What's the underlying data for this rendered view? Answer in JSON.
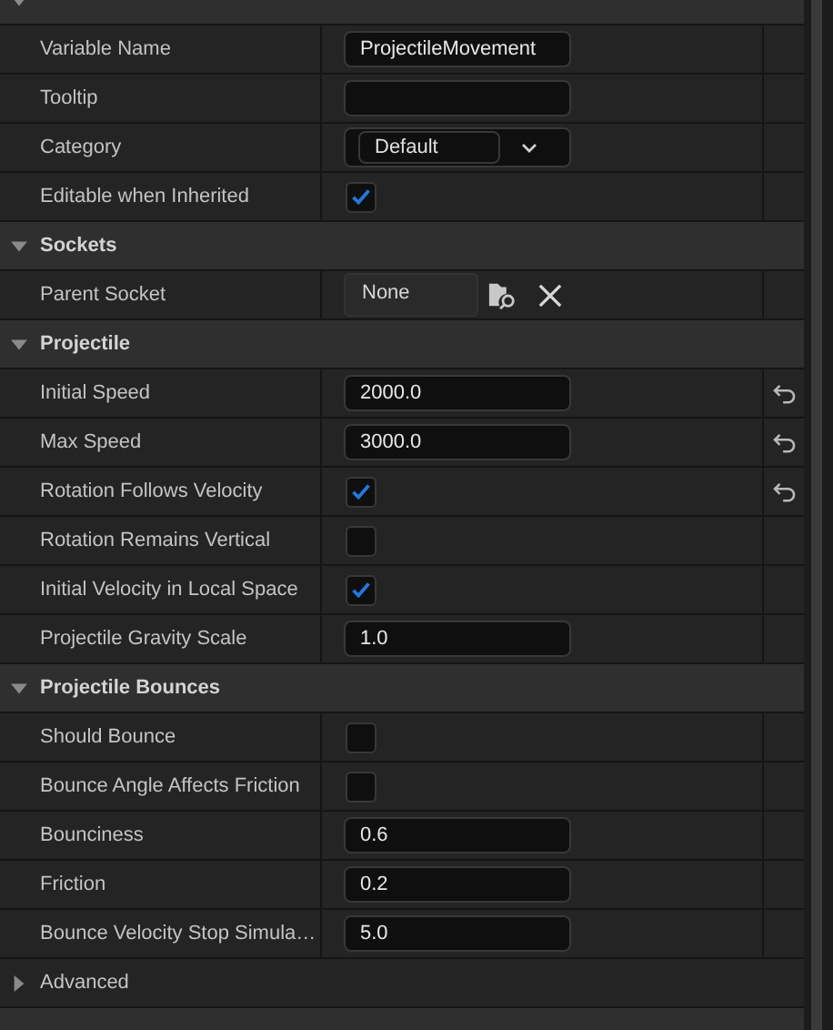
{
  "sections": [
    {
      "expanded": true,
      "rows": [
        {
          "kind": "text",
          "label": "Variable Name",
          "value": "ProjectileMovement",
          "reset": false
        },
        {
          "kind": "text",
          "label": "Tooltip",
          "value": "",
          "reset": false
        },
        {
          "kind": "dropdown",
          "label": "Category",
          "value": "Default",
          "reset": false
        },
        {
          "kind": "checkbox",
          "label": "Editable when Inherited",
          "checked": true,
          "reset": false
        }
      ]
    },
    {
      "title": "Sockets",
      "expanded": true,
      "rows": [
        {
          "kind": "asset",
          "label": "Parent Socket",
          "value": "None",
          "reset": false
        }
      ]
    },
    {
      "title": "Projectile",
      "expanded": true,
      "rows": [
        {
          "kind": "text",
          "label": "Initial Speed",
          "value": "2000.0",
          "reset": true
        },
        {
          "kind": "text",
          "label": "Max Speed",
          "value": "3000.0",
          "reset": true
        },
        {
          "kind": "checkbox",
          "label": "Rotation Follows Velocity",
          "checked": true,
          "reset": true
        },
        {
          "kind": "checkbox",
          "label": "Rotation Remains Vertical",
          "checked": false,
          "reset": false
        },
        {
          "kind": "checkbox",
          "label": "Initial Velocity in Local Space",
          "checked": true,
          "reset": false
        },
        {
          "kind": "text",
          "label": "Projectile Gravity Scale",
          "value": "1.0",
          "reset": false
        }
      ]
    },
    {
      "title": "Projectile Bounces",
      "expanded": true,
      "rows": [
        {
          "kind": "checkbox",
          "label": "Should Bounce",
          "checked": false,
          "reset": false
        },
        {
          "kind": "checkbox",
          "label": "Bounce Angle Affects Friction",
          "checked": false,
          "reset": false
        },
        {
          "kind": "text",
          "label": "Bounciness",
          "value": "0.6",
          "reset": false
        },
        {
          "kind": "text",
          "label": "Friction",
          "value": "0.2",
          "reset": false
        },
        {
          "kind": "text",
          "label": "Bounce Velocity Stop Simula…",
          "value": "5.0",
          "reset": false
        },
        {
          "kind": "group",
          "label": "Advanced",
          "expanded": false
        }
      ]
    }
  ]
}
